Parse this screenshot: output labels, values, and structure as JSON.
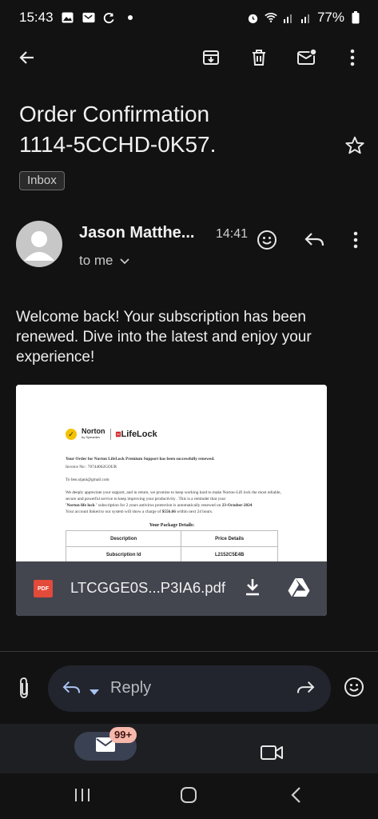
{
  "status_bar": {
    "time": "15:43",
    "battery": "77%",
    "icons": [
      "gallery-icon",
      "voicemail-icon",
      "sync-icon",
      "dot-icon",
      "alarm-icon",
      "wifi-icon",
      "signal-icon",
      "signal-icon-2",
      "battery-icon"
    ]
  },
  "toolbar": {
    "icons": [
      "back-arrow-icon",
      "archive-icon",
      "trash-icon",
      "mark-unread-icon",
      "more-vert-icon"
    ]
  },
  "email": {
    "subject": "Order Confirmation\n1114-5CCHD-0K57.",
    "label": "Inbox",
    "sender": "Jason Matthe...",
    "time": "14:41",
    "to": "to me",
    "body": "Welcome back! Your subscription has been renewed. Dive into the latest and enjoy your experience!"
  },
  "attachment": {
    "filename": "LTCGGE0S...P3IA6.pdf",
    "type_label": "PDF",
    "preview": {
      "logo_left": "Norton",
      "logo_left_sub": "by Symantec",
      "logo_right": "LifeLock",
      "headline": "Your Order for Norton LifeLock Premium Support has been successfully renewed.",
      "invoice": "Invoice No : 70744062GOUR",
      "to": "To ben.stjani@gmail.com",
      "para1": "We deeply appreciate your support, and in return, we promise to keep working hard to make Norton-Lifi lock the most reliable, secure and powerful service to keep improving your productivity . This is a reminder that your",
      "para2_bold1": "'Norton life lock '",
      "para2_mid": " subscription for 2 years antivirus protection is automatically renewed on ",
      "para2_bold2": "23-October-2024",
      "para3_start": "Your account linked to our system will show a charge of ",
      "para3_bold": "$556.66",
      "para3_end": " within next 24 hours.",
      "package_title": "Your Package Details:",
      "table": [
        [
          "Description",
          "Price Details"
        ],
        [
          "Subscription Id",
          "L2152C5E4B"
        ]
      ]
    }
  },
  "reply": {
    "placeholder": "Reply"
  },
  "bottom_nav": {
    "mail_badge": "99+"
  },
  "colors": {
    "background": "#121212",
    "badge": "#f6b8ab",
    "pdf": "#e24a3a",
    "attachment_bar": "#43454f"
  }
}
